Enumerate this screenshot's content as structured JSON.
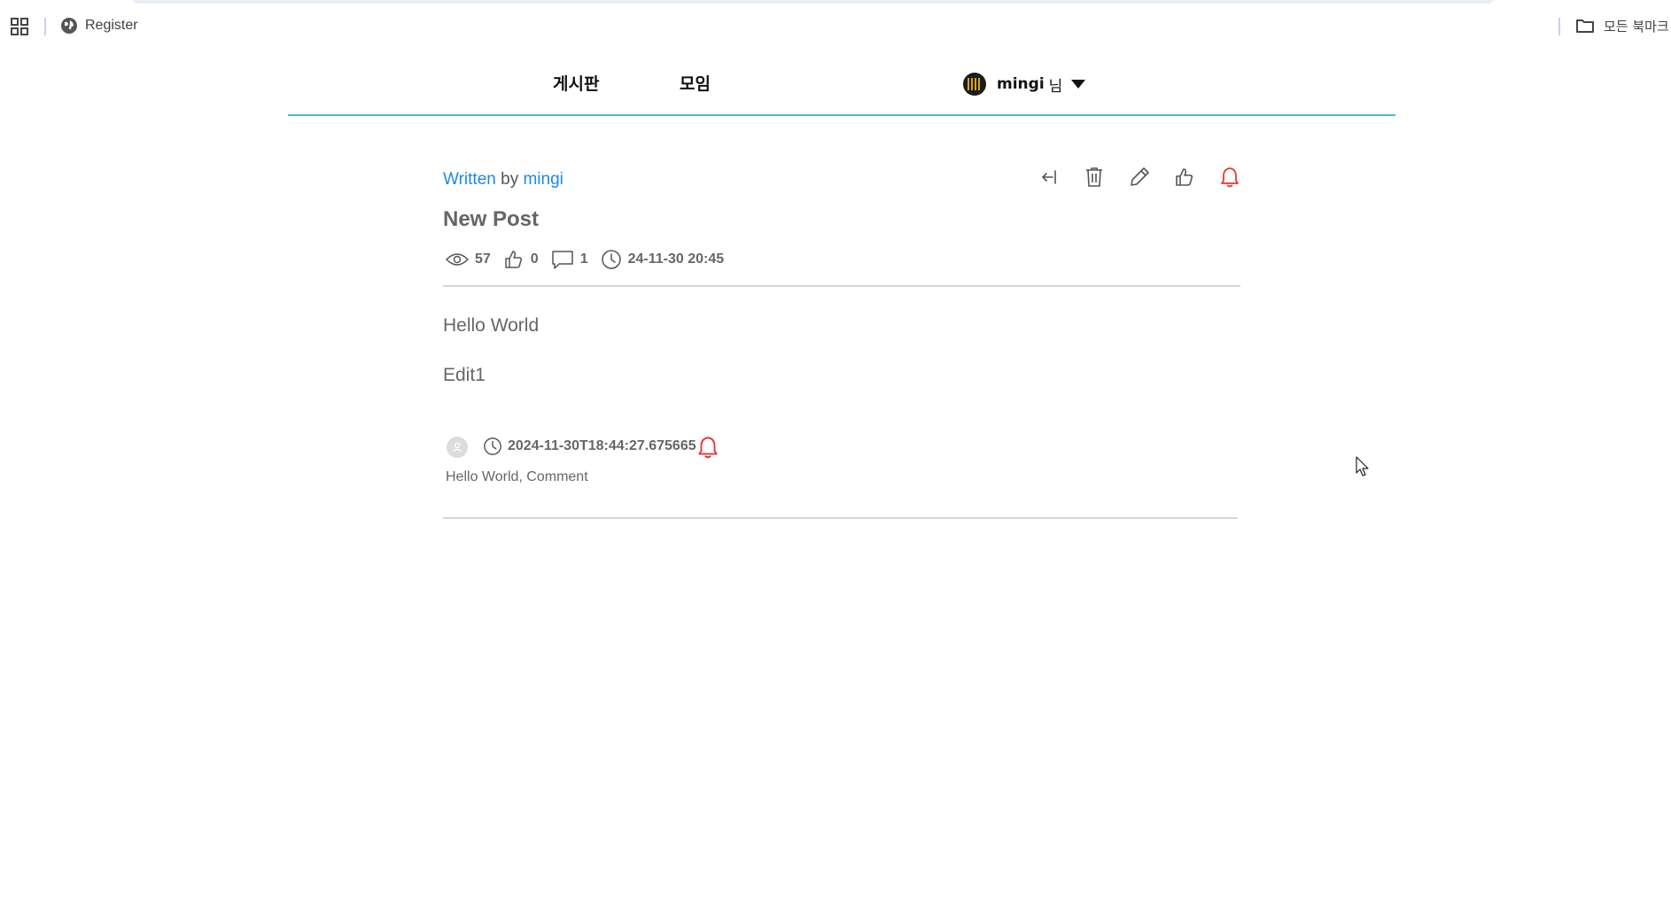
{
  "browser": {
    "bookmarks": {
      "apps_icon": "apps-grid-icon",
      "register_label": "Register",
      "register_icon": "globe-icon",
      "all_bookmarks_label": "모든 북마크",
      "all_bookmarks_icon": "folder-icon"
    }
  },
  "header": {
    "nav": [
      {
        "label": "게시판"
      },
      {
        "label": "모임"
      }
    ],
    "user": {
      "name": "mingi",
      "suffix": "님"
    }
  },
  "post": {
    "byline": {
      "written": "Written",
      "by": "by",
      "author": "mingi"
    },
    "actions": [
      {
        "name": "back",
        "icon": "back-arrow-icon"
      },
      {
        "name": "delete",
        "icon": "trash-icon"
      },
      {
        "name": "edit",
        "icon": "pencil-icon"
      },
      {
        "name": "like",
        "icon": "thumbs-up-icon"
      },
      {
        "name": "notify",
        "icon": "bell-icon"
      }
    ],
    "title": "New Post",
    "meta": {
      "views": "57",
      "likes": "0",
      "comments": "1",
      "date": "24-11-30 20:45"
    },
    "body": [
      "Hello World",
      "Edit1"
    ]
  },
  "comment": {
    "timestamp": "2024-11-30T18:44:27.675665",
    "text": "Hello World, Comment"
  },
  "colors": {
    "accent_blue": "#1e88e5",
    "header_line": "#45bfd4",
    "alert_red": "#e53935",
    "text_gray": "#666666"
  }
}
